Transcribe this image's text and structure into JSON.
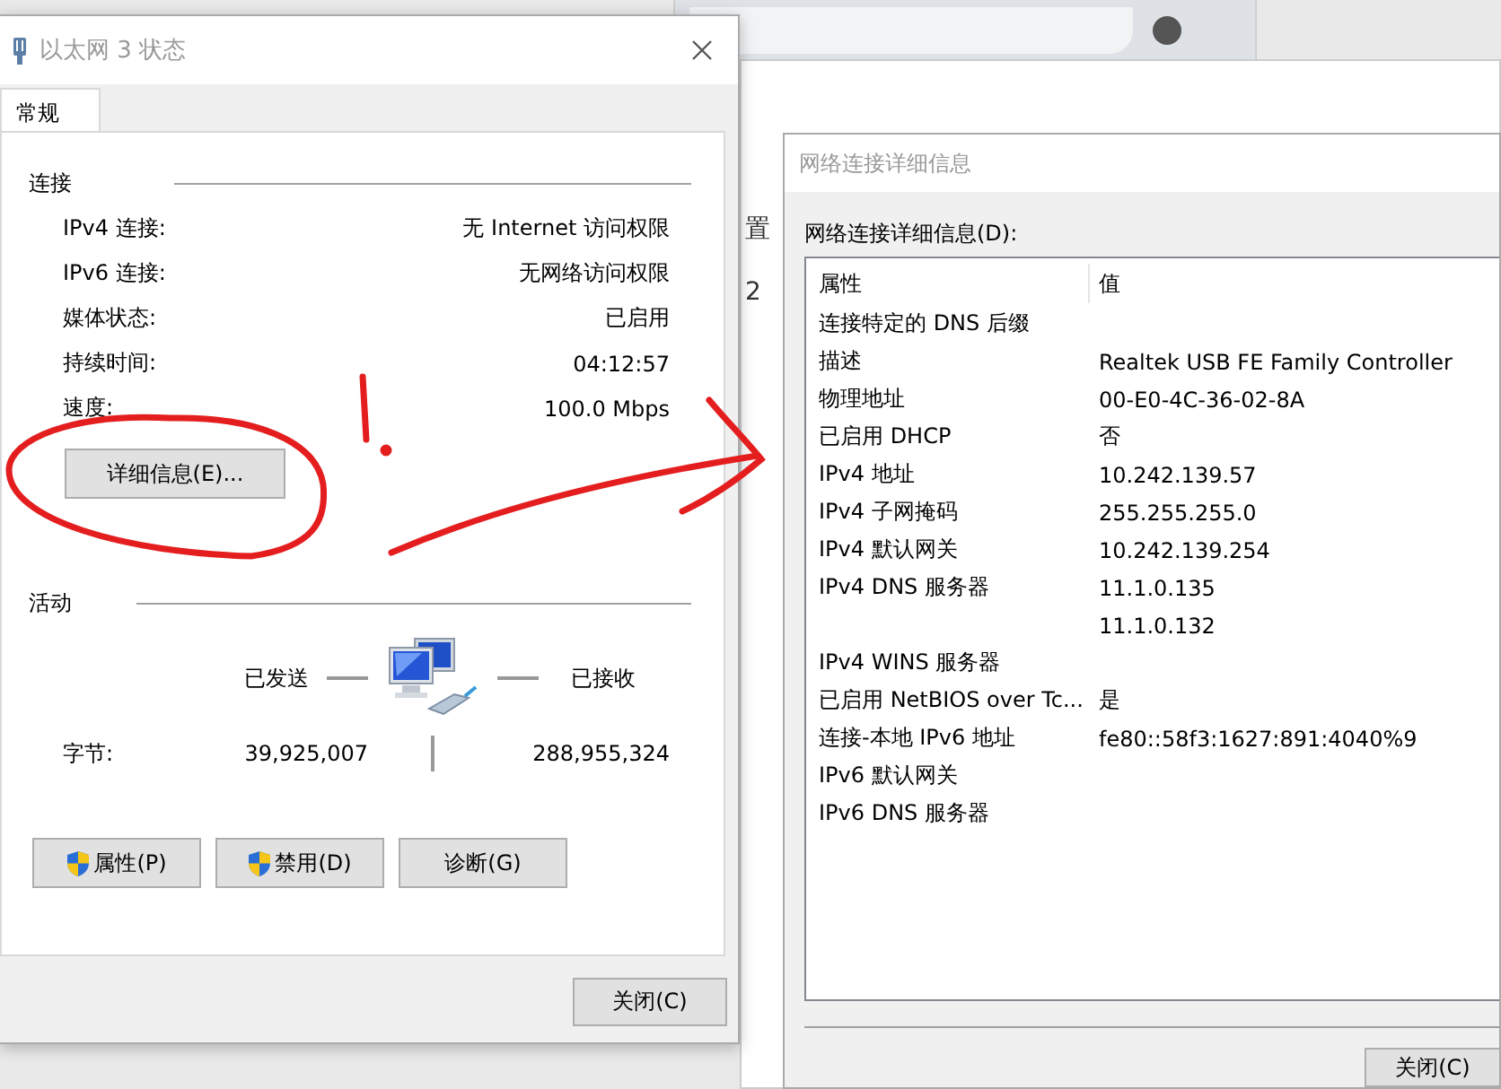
{
  "background_window": {
    "fragments": [
      "置",
      "2"
    ]
  },
  "status_dialog": {
    "title": "以太网 3 状态",
    "tabs": [
      {
        "label": "常规",
        "selected": true
      }
    ],
    "connection": {
      "heading": "连接",
      "rows": [
        {
          "label": "IPv4 连接:",
          "value": "无 Internet 访问权限"
        },
        {
          "label": "IPv6 连接:",
          "value": "无网络访问权限"
        },
        {
          "label": "媒体状态:",
          "value": "已启用"
        },
        {
          "label": "持续时间:",
          "value": "04:12:57"
        },
        {
          "label": "速度:",
          "value": "100.0 Mbps"
        }
      ]
    },
    "details_button": "详细信息(E)...",
    "activity": {
      "heading": "活动",
      "sent_label": "已发送",
      "received_label": "已接收",
      "bytes_label": "字节:",
      "bytes_sent": "39,925,007",
      "bytes_received": "288,955,324"
    },
    "buttons": [
      {
        "label": "属性(P)",
        "shield": true
      },
      {
        "label": "禁用(D)",
        "shield": true
      },
      {
        "label": "诊断(G)",
        "shield": false
      }
    ],
    "close_button": "关闭(C)"
  },
  "details_dialog": {
    "title": "网络连接详细信息",
    "list_label": "网络连接详细信息(D):",
    "columns": [
      "属性",
      "值"
    ],
    "rows": [
      {
        "property": "连接特定的 DNS 后缀"
      },
      {
        "property": "描述",
        "value": "Realtek USB FE Family Controller"
      },
      {
        "property": "物理地址",
        "value": "00-E0-4C-36-02-8A"
      },
      {
        "property": "已启用 DHCP",
        "value": "否"
      },
      {
        "property": "IPv4 地址",
        "value": "10.242.139.57"
      },
      {
        "property": "IPv4 子网掩码",
        "value": "255.255.255.0"
      },
      {
        "property": "IPv4 默认网关",
        "value": "10.242.139.254"
      },
      {
        "property": "IPv4 DNS 服务器",
        "value": "11.1.0.135"
      },
      {
        "value": "11.1.0.132"
      },
      {
        "property": "IPv4 WINS 服务器"
      },
      {
        "property": "已启用 NetBIOS over Tc...",
        "value": "是"
      },
      {
        "property": "连接-本地 IPv6 地址",
        "value": "fe80::58f3:1627:891:4040%9"
      },
      {
        "property": "IPv6 默认网关"
      },
      {
        "property": "IPv6 DNS 服务器"
      }
    ],
    "close_button": "关闭(C)"
  }
}
